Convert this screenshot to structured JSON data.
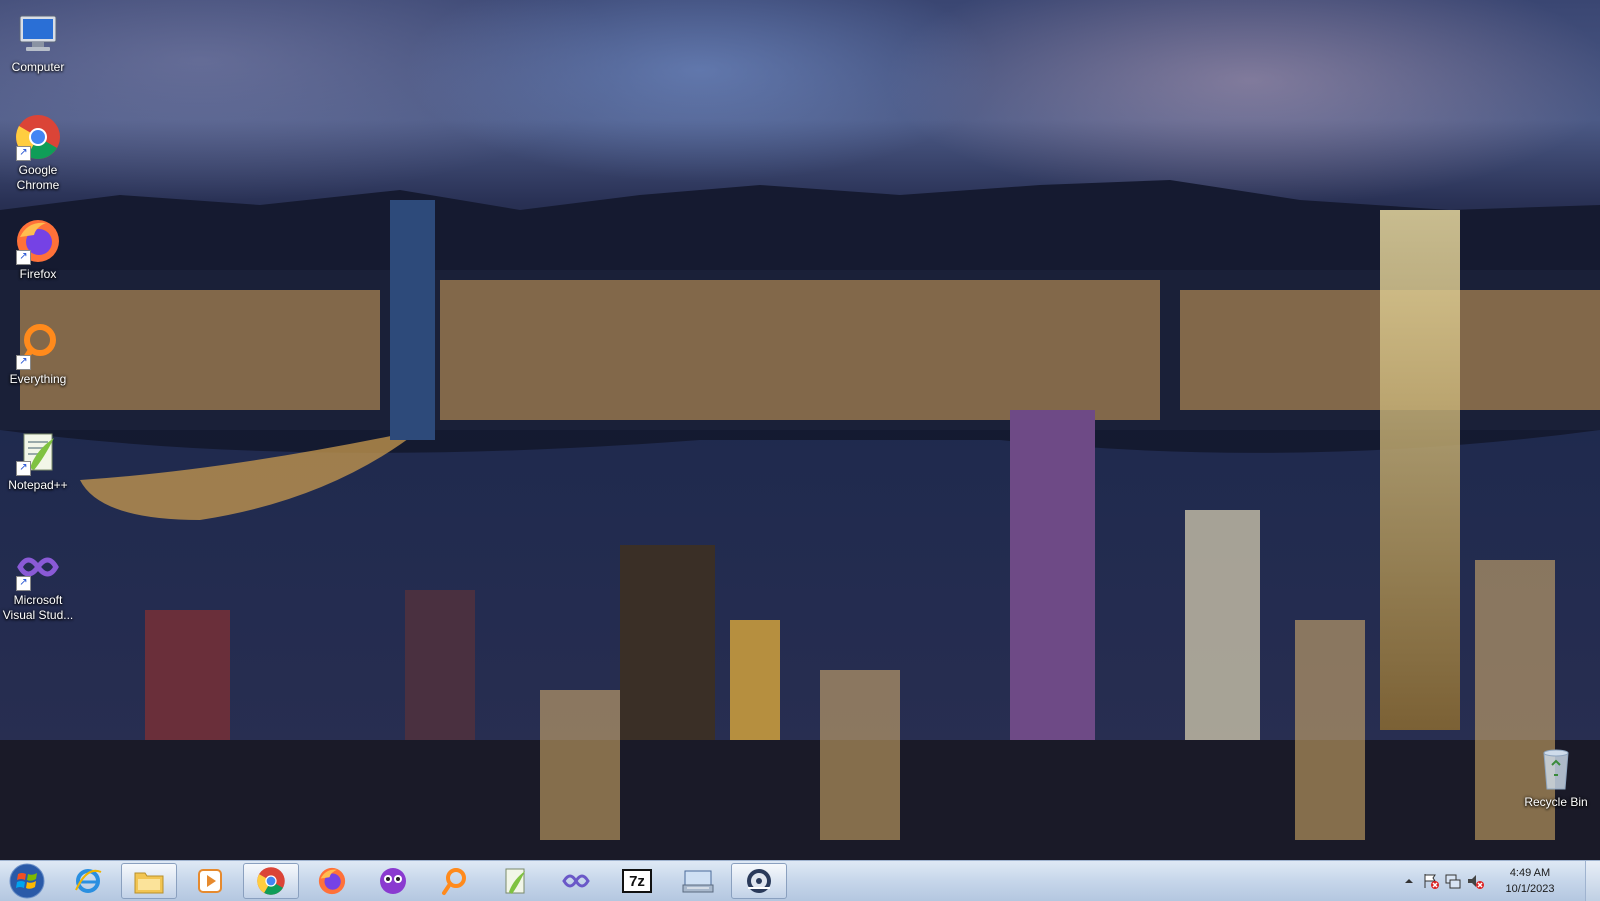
{
  "desktop": {
    "wallpaper": "Hong Kong skyline at night",
    "icons": [
      {
        "label": "Computer",
        "icon": "computer-icon"
      },
      {
        "label": "Google Chrome",
        "icon": "chrome-icon"
      },
      {
        "label": "Firefox",
        "icon": "firefox-icon"
      },
      {
        "label": "Everything",
        "icon": "everything-search-icon"
      },
      {
        "label": "Notepad++",
        "icon": "notepadplusplus-icon"
      },
      {
        "label": "Microsoft Visual Stud...",
        "icon": "visual-studio-icon"
      },
      {
        "label": "Recycle Bin",
        "icon": "recycle-bin-icon"
      }
    ]
  },
  "taskbar": {
    "pinned": [
      {
        "name": "internet-explorer",
        "icon": "internet-explorer-icon",
        "active": false
      },
      {
        "name": "file-explorer",
        "icon": "folder-icon",
        "active": true
      },
      {
        "name": "media-player",
        "icon": "media-player-icon",
        "active": false
      },
      {
        "name": "chrome",
        "icon": "chrome-icon",
        "active": true
      },
      {
        "name": "firefox",
        "icon": "firefox-icon",
        "active": false
      },
      {
        "name": "visual-studio",
        "icon": "visual-studio-icon",
        "active": false
      },
      {
        "name": "everything",
        "icon": "everything-search-icon",
        "active": false
      },
      {
        "name": "notepadplusplus",
        "icon": "notepadplusplus-icon",
        "active": false
      },
      {
        "name": "infinity-app",
        "icon": "infinity-icon",
        "active": false
      },
      {
        "name": "7zip",
        "icon": "7zip-icon",
        "active": false
      },
      {
        "name": "keyboard-app",
        "icon": "keyboard-icon",
        "active": false
      },
      {
        "name": "disk-app",
        "icon": "disk-icon",
        "active": true
      }
    ],
    "sevenzip_label": "7z",
    "clock": {
      "time": "4:49 AM",
      "date": "10/1/2023"
    }
  },
  "colors": {
    "taskbar": "#c6d6ea",
    "accent": "#1a4bd0"
  }
}
